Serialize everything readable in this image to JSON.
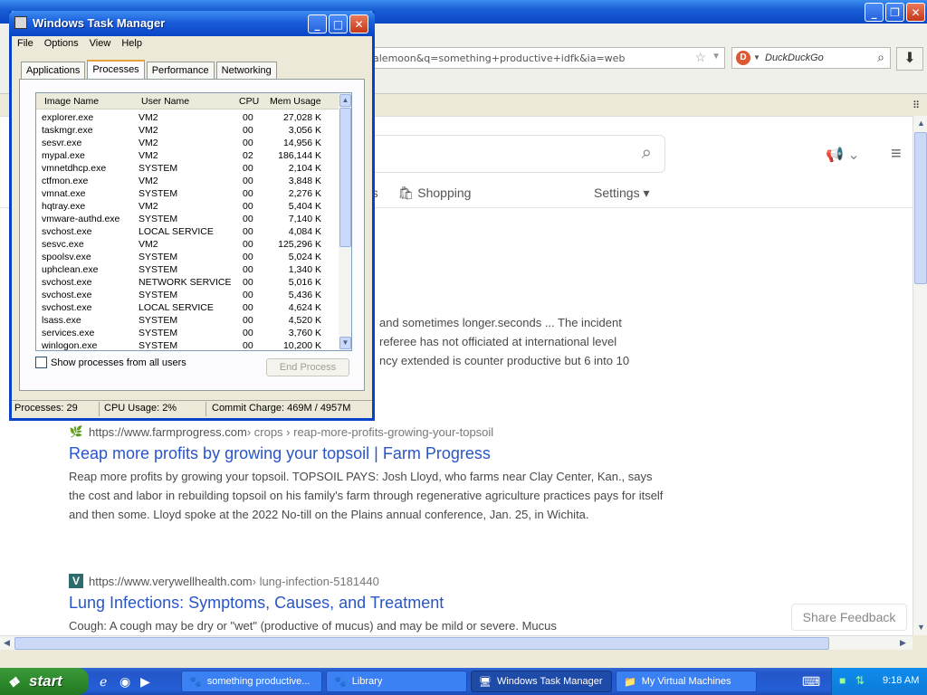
{
  "browser": {
    "url_text": "alemoon&q=something+productive+idfk&ia=web",
    "search_engine": "DuckDuckGo",
    "tabs": [
      "aps",
      "Shopping"
    ],
    "settings_label": "Settings",
    "snippet_lines": [
      "and sometimes longer.seconds ... The incident",
      "referee has not officiated at international level",
      "ncy extended is counter productive but 6 into 10"
    ],
    "results": [
      {
        "url": "https://www.farmprogress.com",
        "path": " › crops › reap-more-profits-growing-your-topsoil",
        "title": "Reap more profits by growing your topsoil | Farm Progress",
        "snippet": "Reap more profits by growing your topsoil. TOPSOIL PAYS: Josh Lloyd, who farms near Clay Center, Kan., says the cost and labor in rebuilding topsoil on his family's farm through regenerative agriculture practices pays for itself and then some. Lloyd spoke at the 2022 No-till on the Plains annual conference, Jan. 25, in Wichita."
      },
      {
        "url": "https://www.verywellhealth.com",
        "path": " › lung-infection-5181440",
        "title": "Lung Infections: Symptoms, Causes, and Treatment",
        "snippet": "Cough: A cough may be dry or \"wet\" (productive of mucus) and may be mild or severe. Mucus"
      }
    ],
    "share_feedback": "Share Feedback"
  },
  "taskmgr": {
    "title": "Windows Task Manager",
    "menu": [
      "File",
      "Options",
      "View",
      "Help"
    ],
    "tabs": [
      "Applications",
      "Processes",
      "Performance",
      "Networking"
    ],
    "columns": [
      "Image Name",
      "User Name",
      "CPU",
      "Mem Usage"
    ],
    "processes": [
      {
        "image": "explorer.exe",
        "user": "VM2",
        "cpu": "00",
        "mem": "27,028 K"
      },
      {
        "image": "taskmgr.exe",
        "user": "VM2",
        "cpu": "00",
        "mem": "3,056 K"
      },
      {
        "image": "sesvr.exe",
        "user": "VM2",
        "cpu": "00",
        "mem": "14,956 K"
      },
      {
        "image": "mypal.exe",
        "user": "VM2",
        "cpu": "02",
        "mem": "186,144 K"
      },
      {
        "image": "vmnetdhcp.exe",
        "user": "SYSTEM",
        "cpu": "00",
        "mem": "2,104 K"
      },
      {
        "image": "ctfmon.exe",
        "user": "VM2",
        "cpu": "00",
        "mem": "3,848 K"
      },
      {
        "image": "vmnat.exe",
        "user": "SYSTEM",
        "cpu": "00",
        "mem": "2,276 K"
      },
      {
        "image": "hqtray.exe",
        "user": "VM2",
        "cpu": "00",
        "mem": "5,404 K"
      },
      {
        "image": "vmware-authd.exe",
        "user": "SYSTEM",
        "cpu": "00",
        "mem": "7,140 K"
      },
      {
        "image": "svchost.exe",
        "user": "LOCAL SERVICE",
        "cpu": "00",
        "mem": "4,084 K"
      },
      {
        "image": "sesvc.exe",
        "user": "VM2",
        "cpu": "00",
        "mem": "125,296 K"
      },
      {
        "image": "spoolsv.exe",
        "user": "SYSTEM",
        "cpu": "00",
        "mem": "5,024 K"
      },
      {
        "image": "uphclean.exe",
        "user": "SYSTEM",
        "cpu": "00",
        "mem": "1,340 K"
      },
      {
        "image": "svchost.exe",
        "user": "NETWORK SERVICE",
        "cpu": "00",
        "mem": "5,016 K"
      },
      {
        "image": "svchost.exe",
        "user": "SYSTEM",
        "cpu": "00",
        "mem": "5,436 K"
      },
      {
        "image": "svchost.exe",
        "user": "LOCAL SERVICE",
        "cpu": "00",
        "mem": "4,624 K"
      },
      {
        "image": "lsass.exe",
        "user": "SYSTEM",
        "cpu": "00",
        "mem": "4,520 K"
      },
      {
        "image": "services.exe",
        "user": "SYSTEM",
        "cpu": "00",
        "mem": "3,760 K"
      },
      {
        "image": "winlogon.exe",
        "user": "SYSTEM",
        "cpu": "00",
        "mem": "10,200 K"
      }
    ],
    "show_all_label": "Show processes from all users",
    "end_process_label": "End Process",
    "status": {
      "processes": "Processes: 29",
      "cpu": "CPU Usage: 2%",
      "commit": "Commit Charge: 469M / 4957M"
    }
  },
  "taskbar": {
    "start_label": "start",
    "tasks": [
      "something productive...",
      "Library",
      "Windows Task Manager",
      "My Virtual Machines"
    ],
    "clock": "9:18 AM"
  }
}
